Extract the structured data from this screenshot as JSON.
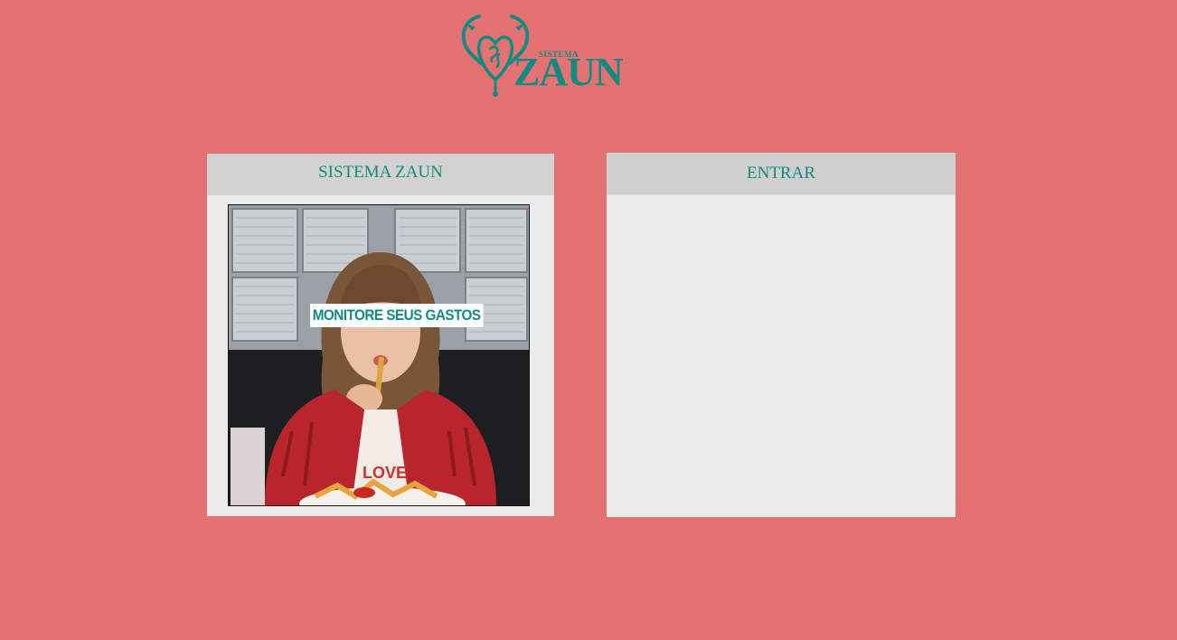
{
  "brand": {
    "logo_small": "SISTEMA",
    "logo_big": "ZAUN",
    "logo_color": "#138a80"
  },
  "left_panel": {
    "title": "SISTEMA ZAUN",
    "image_caption": "MONITORE SEUS GASTOS"
  },
  "right_panel": {
    "title": "ENTRAR"
  },
  "colors": {
    "background": "#e57272",
    "panel": "#eaeaea",
    "panel_header": "#d2d2d2",
    "accent": "#16897d"
  }
}
